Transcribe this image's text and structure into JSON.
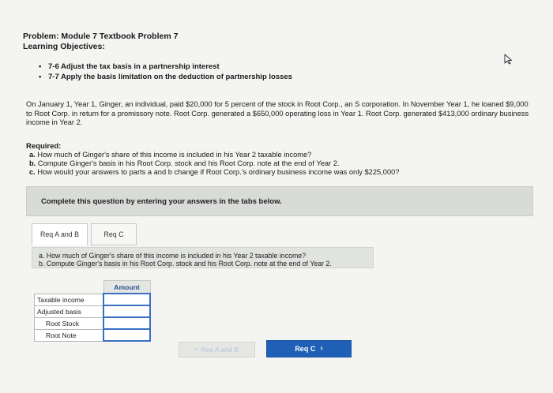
{
  "header": {
    "title": "Problem: Module 7 Textbook Problem 7",
    "subtitle": "Learning Objectives:"
  },
  "objectives": [
    "7-6 Adjust the tax basis in a partnership interest",
    "7-7 Apply the basis limitation on the deduction of partnership losses"
  ],
  "problem_text": "On January 1, Year 1, Ginger, an individual, paid $20,000 for 5 percent of the stock in Root Corp., an S corporation. In November Year 1, he loaned $9,000 to Root Corp. in return for a promissory note. Root Corp. generated a $650,000 operating loss in Year 1. Root Corp. generated $413,000 ordinary business income in Year 2.",
  "required": {
    "heading": "Required:",
    "items": [
      {
        "letter": "a.",
        "text": "How much of Ginger's share of this income is included in his Year 2 taxable income?"
      },
      {
        "letter": "b.",
        "text": "Compute Ginger's basis in his Root Corp. stock and his Root Corp. note at the end of Year 2."
      },
      {
        "letter": "c.",
        "text": "How would your answers to parts a and b change if Root Corp.'s ordinary business income was only $225,000?"
      }
    ]
  },
  "instruction": "Complete this question by entering your answers in the tabs below.",
  "tabs": [
    {
      "label": "Req A and B"
    },
    {
      "label": "Req C"
    }
  ],
  "questions": {
    "q1": "a. How much of Ginger's share of this income is included in his Year 2 taxable income?",
    "q2": "b. Compute Ginger's basis in his Root Corp. stock and his Root Corp. note at the end of Year 2."
  },
  "table": {
    "column_header": "Amount",
    "rows": [
      {
        "label": "Taxable income",
        "value": "",
        "input": true
      },
      {
        "label": "Adjusted basis",
        "value": "",
        "input": false
      },
      {
        "label": "Root Stock",
        "value": "",
        "input": true
      },
      {
        "label": "Root Note",
        "value": "",
        "input": true
      }
    ]
  },
  "nav": {
    "prev_label": "Req A and B",
    "next_label": "Req C",
    "prev_glyph": "‹",
    "next_glyph": "›"
  },
  "colors": {
    "accent": "#1f5fb5",
    "input_border": "#3a6fc4",
    "amount_header": "#2d4f8f"
  }
}
